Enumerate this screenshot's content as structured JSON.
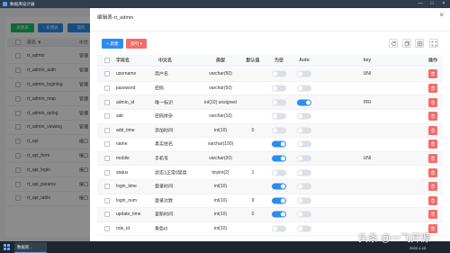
{
  "app": {
    "title": "数据库设计器",
    "window_controls": {
      "minimize": "—",
      "maximize": "□",
      "close": "×"
    }
  },
  "background": {
    "toolbar": {
      "buttons": [
        {
          "label": "新建表",
          "color": "#19be6b"
        },
        {
          "label": "+ 新建表",
          "color": "#2d8cf0"
        },
        {
          "label": "操作",
          "color": "#2d8cf0"
        }
      ]
    },
    "table_list": {
      "headers": {
        "name": "表名 ▼",
        "comment": "中文"
      },
      "rows": [
        {
          "name": "rt_admin",
          "comment": "管理"
        },
        {
          "name": "rt_admin_auth",
          "comment": "管理"
        },
        {
          "name": "rt_admin_loginlog",
          "comment": "管理"
        },
        {
          "name": "rt_admin_map",
          "comment": "管理"
        },
        {
          "name": "rt_admin_oplog",
          "comment": "管理"
        },
        {
          "name": "rt_admin_viewlog",
          "comment": "管理"
        },
        {
          "name": "rt_api",
          "comment": "接口"
        },
        {
          "name": "rt_api_form",
          "comment": "接口"
        },
        {
          "name": "rt_api_login",
          "comment": "接口"
        },
        {
          "name": "rt_api_params",
          "comment": "接口"
        },
        {
          "name": "rt_api_table",
          "comment": "接口"
        }
      ]
    }
  },
  "modal": {
    "title": "编辑表-rt_admin",
    "close": "×",
    "toolbar": {
      "new_label": "+ 新建",
      "index_label": "索引 ▾",
      "icons": [
        "refresh-icon",
        "copy-icon",
        "grid-icon",
        "fullscreen-icon"
      ]
    },
    "columns": {
      "field": "字段名",
      "comment": "中文名",
      "type": "类型",
      "default": "默认值",
      "nullable": "为空",
      "auto": "Auto",
      "key": "key",
      "actions": "操作"
    },
    "fields": [
      {
        "name": "username",
        "comment": "用户名",
        "type": "varchar(50)",
        "default": "",
        "nullable": false,
        "auto": false,
        "key": "UNI"
      },
      {
        "name": "password",
        "comment": "密码",
        "type": "varchar(50)",
        "default": "",
        "nullable": false,
        "auto": false,
        "key": ""
      },
      {
        "name": "admin_id",
        "comment": "唯一标识",
        "type": "int(10) unsigned",
        "default": "",
        "nullable": false,
        "auto": true,
        "key": "PRI"
      },
      {
        "name": "salt",
        "comment": "密码掺杂",
        "type": "varchar(16)",
        "default": "",
        "nullable": false,
        "auto": false,
        "key": ""
      },
      {
        "name": "add_time",
        "comment": "添加时间",
        "type": "int(10)",
        "default": "0",
        "nullable": false,
        "auto": false,
        "key": ""
      },
      {
        "name": "name",
        "comment": "真实姓名",
        "type": "varchar(100)",
        "default": "",
        "nullable": true,
        "auto": false,
        "key": ""
      },
      {
        "name": "mobile",
        "comment": "手机号",
        "type": "varchar(20)",
        "default": "",
        "nullable": true,
        "auto": false,
        "key": "UNI"
      },
      {
        "name": "status",
        "comment": "状态1正常0禁用",
        "type": "tinyint(2)",
        "default": "1",
        "nullable": false,
        "auto": false,
        "key": ""
      },
      {
        "name": "login_time",
        "comment": "登录时间",
        "type": "int(10)",
        "default": "",
        "nullable": true,
        "auto": false,
        "key": ""
      },
      {
        "name": "login_num",
        "comment": "登录次数",
        "type": "int(10)",
        "default": "0",
        "nullable": true,
        "auto": false,
        "key": ""
      },
      {
        "name": "update_time",
        "comment": "更新时间",
        "type": "int(10)",
        "default": "0",
        "nullable": true,
        "auto": false,
        "key": ""
      },
      {
        "name": "role_id",
        "comment": "角色id",
        "type": "int(10)",
        "default": "",
        "nullable": false,
        "auto": false,
        "key": ""
      }
    ]
  },
  "taskbar": {
    "app_tab": "数据库...",
    "date": "2022-1-15"
  },
  "watermark": "头条 @一飞开源",
  "colors": {
    "accent": "#2d8cf0",
    "danger": "#f56c6c",
    "success": "#19be6b",
    "toggle_off": "#dcdfe6",
    "titlebar": "#2f3d4d",
    "taskbar": "#1b2631"
  }
}
